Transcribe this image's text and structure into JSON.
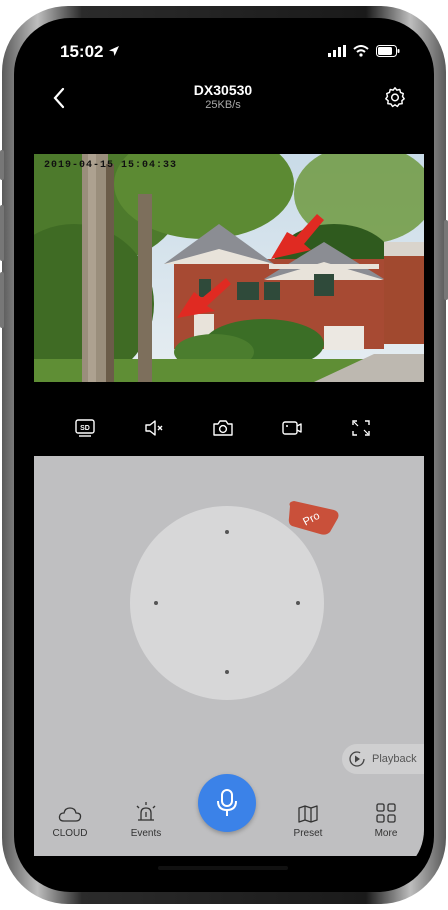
{
  "status": {
    "time": "15:02"
  },
  "header": {
    "title": "DX30530",
    "subtitle": "25KB/s"
  },
  "video": {
    "osd_timestamp": "2019-04-15 15:04:33"
  },
  "controls": [
    "sd-icon",
    "mute-icon",
    "camera-icon",
    "record-icon",
    "fullscreen-icon"
  ],
  "panel": {
    "pro_label": "Pro",
    "playback_label": "Playback"
  },
  "tabs": {
    "cloud": "CLOUD",
    "events": "Events",
    "preset": "Preset",
    "more": "More"
  },
  "colors": {
    "accent": "#3b82e8",
    "pro_badge": "#c9503a",
    "panel_bg": "#bfbfc1"
  }
}
